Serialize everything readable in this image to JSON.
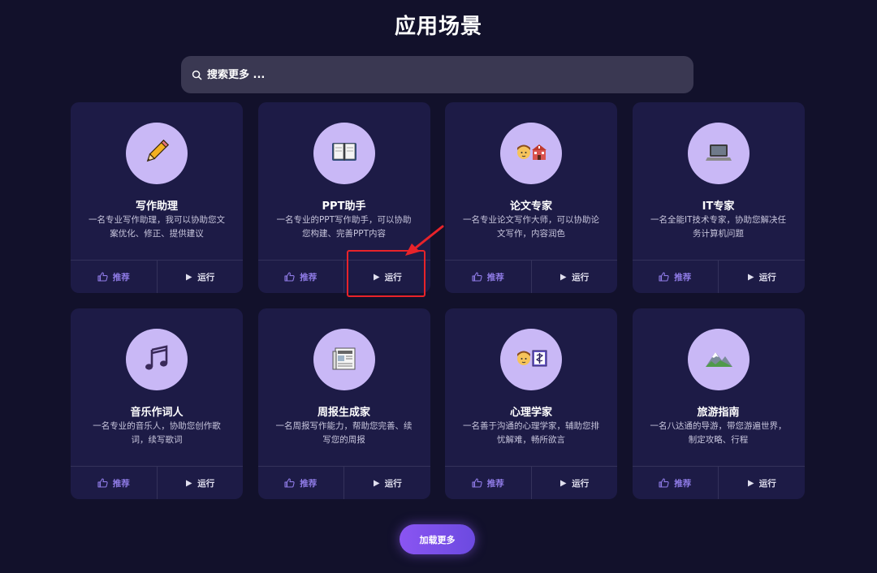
{
  "page_title": "应用场景",
  "search": {
    "placeholder": "搜索更多 ..."
  },
  "cards": [
    {
      "name": "写作助理",
      "desc": "一名专业写作助理，我可以协助您文案优化、修正、提供建议",
      "icon": "pencil-icon",
      "recommend": "推荐",
      "run": "运行"
    },
    {
      "name": "PPT助手",
      "desc": "一名专业的PPT写作助手，可以协助您构建、完善PPT内容",
      "icon": "book-icon",
      "recommend": "推荐",
      "run": "运行"
    },
    {
      "name": "论文专家",
      "desc": "一名专业论文写作大师，可以协助论文写作，内容润色",
      "icon": "student-school-icon",
      "recommend": "推荐",
      "run": "运行"
    },
    {
      "name": "IT专家",
      "desc": "一名全能IT技术专家，协助您解决任务计算机问题",
      "icon": "laptop-icon",
      "recommend": "推荐",
      "run": "运行"
    },
    {
      "name": "音乐作词人",
      "desc": "一名专业的音乐人，协助您创作歌词，续写歌词",
      "icon": "music-note-icon",
      "recommend": "推荐",
      "run": "运行"
    },
    {
      "name": "周报生成家",
      "desc": "一名周报写作能力，帮助您完善、续写您的周报",
      "icon": "newspaper-icon",
      "recommend": "推荐",
      "run": "运行"
    },
    {
      "name": "心理学家",
      "desc": "一名善于沟通的心理学家，辅助您排忧解难，畅所欲言",
      "icon": "person-medical-icon",
      "recommend": "推荐",
      "run": "运行"
    },
    {
      "name": "旅游指南",
      "desc": "一名八达通的导游，带您游遍世界，制定攻略、行程",
      "icon": "mountain-icon",
      "recommend": "推荐",
      "run": "运行"
    }
  ],
  "load_more": "加载更多",
  "colors": {
    "background": "#12112b",
    "card": "#1d1b46",
    "icon_circle": "#c9b8f6",
    "accent": "#8f7be6",
    "highlight": "#e8232a"
  }
}
